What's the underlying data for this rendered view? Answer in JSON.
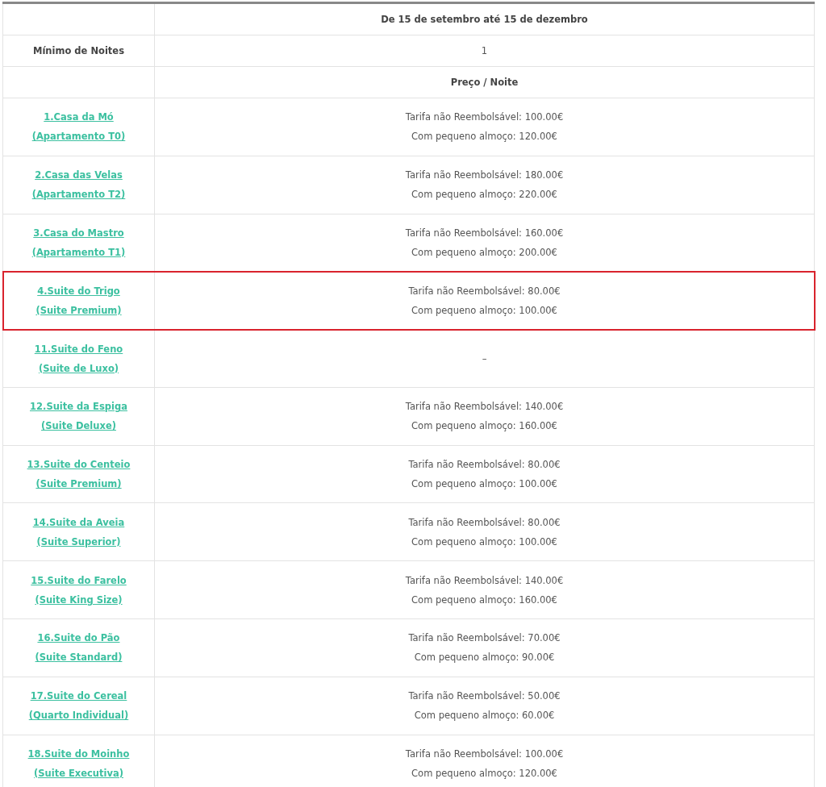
{
  "table": {
    "period_header": "De 15 de setembro até 15 de dezembro",
    "min_nights": {
      "label": "Mínimo de Noites",
      "value": "1"
    },
    "price_header": "Preço / Noite",
    "rows": [
      {
        "name": "1.Casa da Mó",
        "type": "(Apartamento T0)",
        "prices": [
          "Tarifa não Reembolsável: 100.00€",
          "Com pequeno almoço: 120.00€"
        ],
        "highlighted": false
      },
      {
        "name": "2.Casa das Velas",
        "type": "(Apartamento T2)",
        "prices": [
          "Tarifa não Reembolsável: 180.00€",
          "Com pequeno almoço: 220.00€"
        ],
        "highlighted": false
      },
      {
        "name": "3.Casa do Mastro",
        "type": "(Apartamento T1)",
        "prices": [
          "Tarifa não Reembolsável: 160.00€",
          "Com pequeno almoço: 200.00€"
        ],
        "highlighted": false
      },
      {
        "name": "4.Suite do Trigo",
        "type": "(Suite Premium)",
        "prices": [
          "Tarifa não Reembolsável: 80.00€",
          "Com pequeno almoço: 100.00€"
        ],
        "highlighted": true
      },
      {
        "name": "11.Suite do Feno",
        "type": "(Suite de Luxo)",
        "prices": [
          "–"
        ],
        "highlighted": false
      },
      {
        "name": "12.Suite da Espiga",
        "type": "(Suite Deluxe)",
        "prices": [
          "Tarifa não Reembolsável: 140.00€",
          "Com pequeno almoço: 160.00€"
        ],
        "highlighted": false
      },
      {
        "name": "13.Suite do Centeio",
        "type": "(Suite Premium)",
        "prices": [
          "Tarifa não Reembolsável: 80.00€",
          "Com pequeno almoço: 100.00€"
        ],
        "highlighted": false
      },
      {
        "name": "14.Suite da Aveia",
        "type": "(Suite Superior)",
        "prices": [
          "Tarifa não Reembolsável: 80.00€",
          "Com pequeno almoço: 100.00€"
        ],
        "highlighted": false
      },
      {
        "name": "15.Suite do Farelo",
        "type": "(Suite King Size)",
        "prices": [
          "Tarifa não Reembolsável: 140.00€",
          "Com pequeno almoço: 160.00€"
        ],
        "highlighted": false
      },
      {
        "name": "16.Suite do Pão",
        "type": "(Suite Standard)",
        "prices": [
          "Tarifa não Reembolsável: 70.00€",
          "Com pequeno almoço: 90.00€"
        ],
        "highlighted": false
      },
      {
        "name": "17.Suite do Cereal",
        "type": "(Quarto Individual)",
        "prices": [
          "Tarifa não Reembolsável: 50.00€",
          "Com pequeno almoço: 60.00€"
        ],
        "highlighted": false
      },
      {
        "name": "18.Suite do Moinho",
        "type": "(Suite Executiva)",
        "prices": [
          "Tarifa não Reembolsável: 100.00€",
          "Com pequeno almoço: 120.00€"
        ],
        "highlighted": false
      }
    ]
  }
}
